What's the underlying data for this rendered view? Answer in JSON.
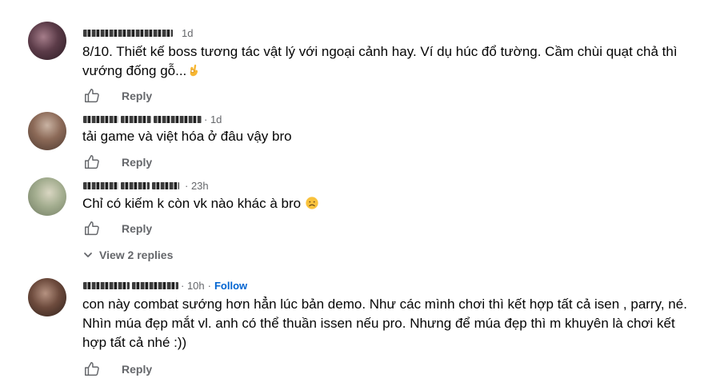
{
  "comments": [
    {
      "time": "1d",
      "text": "8/10. Thiết kế boss tương tác vật lý với ngoại cảnh hay. Ví dụ húc đổ tường. Cầm chùi quạt chả thì vướng đống gỗ...",
      "emoji": "ok-hand",
      "reply": "Reply"
    },
    {
      "time": "· 1d",
      "text": "tải game và việt hóa ở đâu vậy bro",
      "reply": "Reply"
    },
    {
      "time": "· 23h",
      "text": "Chỉ có kiếm k còn vk nào khác à bro",
      "emoji": "disappointed-face",
      "reply": "Reply",
      "view_replies": "View 2 replies"
    },
    {
      "time": "· 10h",
      "follow": "Follow",
      "text": "con này combat sướng hơn hẳn lúc bản demo. Như các mình chơi thì kết hợp tất cả isen , parry, né. Nhìn múa đẹp mắt vl. anh có thể thuần issen nếu pro. Nhưng để múa đẹp thì m khuyên là chơi kết hợp tất cả nhé :))",
      "reply": "Reply"
    }
  ],
  "colors": {
    "text": "#050505",
    "secondary": "#65676b",
    "link": "#0064d1"
  }
}
